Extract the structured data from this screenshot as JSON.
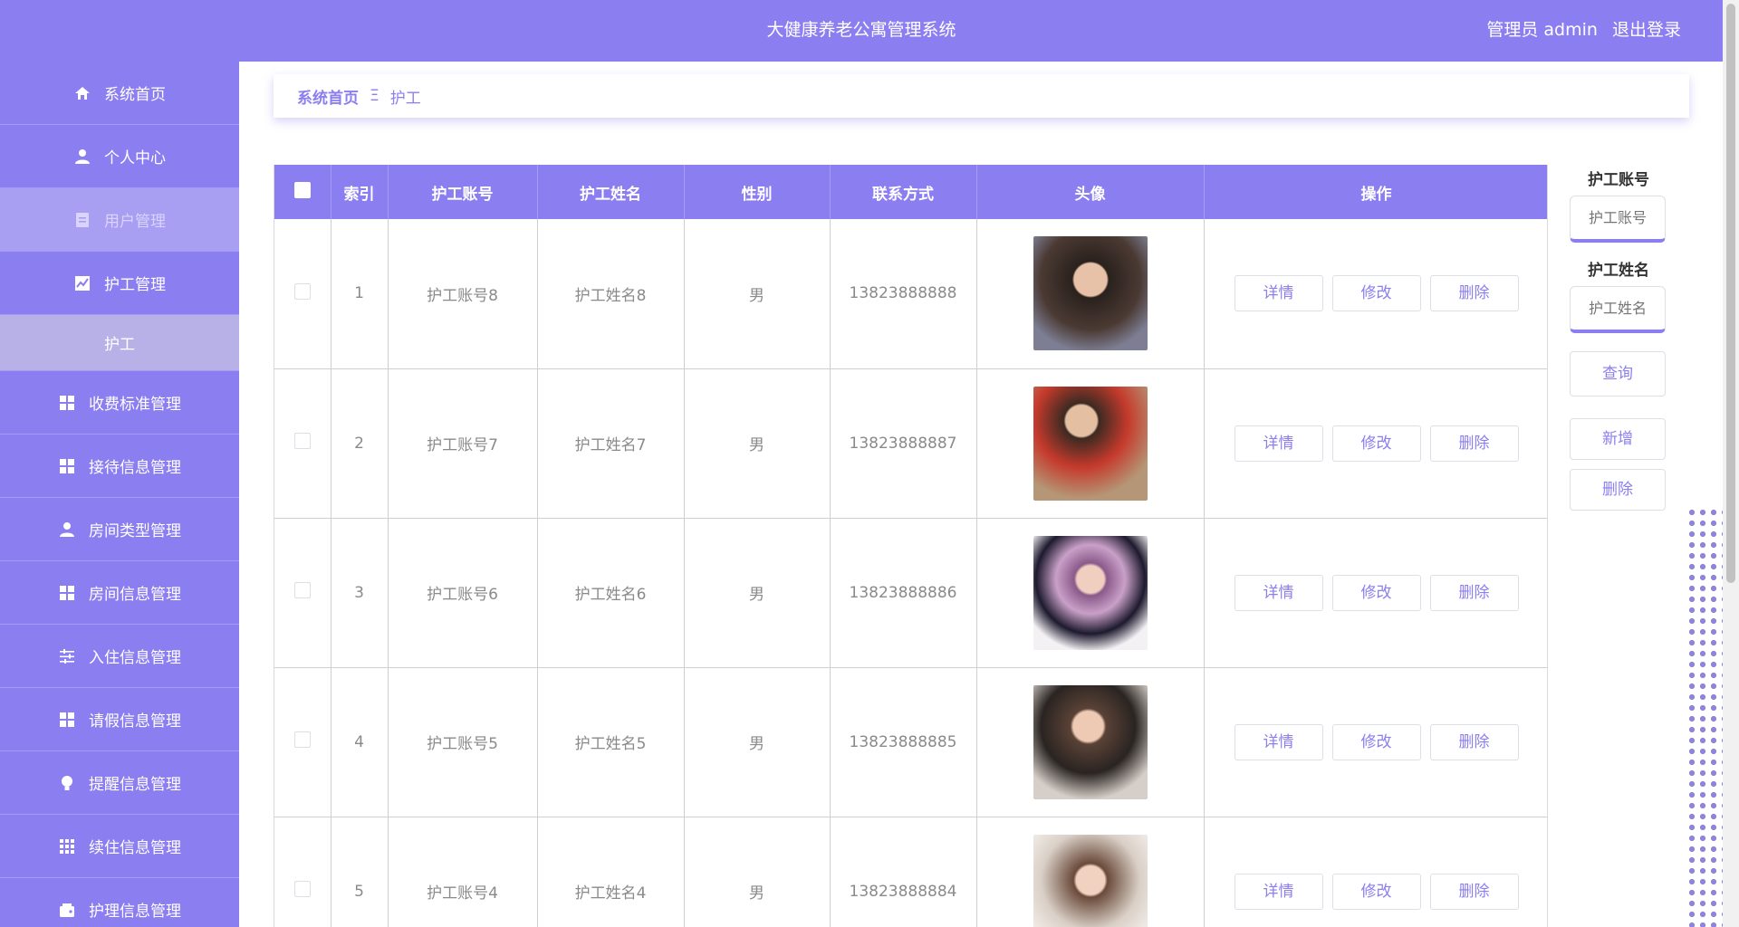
{
  "header": {
    "title": "大健康养老公寓管理系统",
    "user_label": "管理员 admin",
    "logout_label": "退出登录"
  },
  "sidebar": {
    "items": [
      {
        "label": "系统首页",
        "icon": "home-icon"
      },
      {
        "label": "个人中心",
        "icon": "user-icon"
      },
      {
        "label": "用户管理",
        "icon": "document-icon"
      },
      {
        "label": "护工管理",
        "icon": "chart-icon"
      },
      {
        "label": "护工",
        "icon": ""
      },
      {
        "label": "收费标准管理",
        "icon": "grid-icon"
      },
      {
        "label": "接待信息管理",
        "icon": "grid-icon"
      },
      {
        "label": "房间类型管理",
        "icon": "user-icon"
      },
      {
        "label": "房间信息管理",
        "icon": "grid-icon"
      },
      {
        "label": "入住信息管理",
        "icon": "sliders-icon"
      },
      {
        "label": "请假信息管理",
        "icon": "grid-icon"
      },
      {
        "label": "提醒信息管理",
        "icon": "bulb-icon"
      },
      {
        "label": "续住信息管理",
        "icon": "apps-icon"
      },
      {
        "label": "护理信息管理",
        "icon": "wallet-icon"
      }
    ]
  },
  "breadcrumb": {
    "home": "系统首页",
    "separator": "Ξ",
    "current": "护工"
  },
  "table": {
    "columns": [
      "索引",
      "护工账号",
      "护工姓名",
      "性别",
      "联系方式",
      "头像",
      "操作"
    ],
    "rows": [
      {
        "index": "1",
        "account": "护工账号8",
        "name": "护工姓名8",
        "gender": "男",
        "phone": "13823888888"
      },
      {
        "index": "2",
        "account": "护工账号7",
        "name": "护工姓名7",
        "gender": "男",
        "phone": "13823888887"
      },
      {
        "index": "3",
        "account": "护工账号6",
        "name": "护工姓名6",
        "gender": "男",
        "phone": "13823888886"
      },
      {
        "index": "4",
        "account": "护工账号5",
        "name": "护工姓名5",
        "gender": "男",
        "phone": "13823888885"
      },
      {
        "index": "5",
        "account": "护工账号4",
        "name": "护工姓名4",
        "gender": "男",
        "phone": "13823888884"
      }
    ],
    "actions": {
      "detail": "详情",
      "edit": "修改",
      "delete": "删除"
    }
  },
  "search": {
    "account_label": "护工账号",
    "account_placeholder": "护工账号",
    "name_label": "护工姓名",
    "name_placeholder": "护工姓名",
    "query_label": "查询",
    "add_label": "新增",
    "delete_label": "删除"
  },
  "colors": {
    "accent": "#8b7ef0"
  }
}
